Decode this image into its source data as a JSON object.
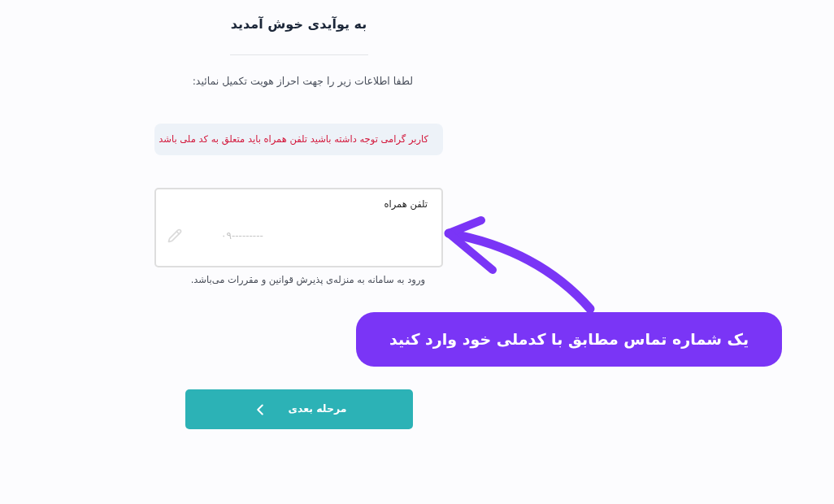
{
  "title": "به یوآیدی خوش آمدید",
  "subtitle": "لطفا اطلاعات زیر را جهت احراز هویت تکمیل نمائید:",
  "alert": "کاربر گرامی توجه داشته باشید تلفن همراه باید متعلق به کد ملی باشد",
  "phone_field": {
    "label": "تلفن همراه",
    "placeholder": "۰۹---------"
  },
  "terms": "ورود به سامانه به منزله‌ی پذیرش قوانین و مقررات می‌باشد.",
  "next_button": {
    "label": "مرحله بعدی"
  },
  "callout": {
    "text": "یک شماره تماس مطابق با کدملی خود وارد کنید"
  }
}
